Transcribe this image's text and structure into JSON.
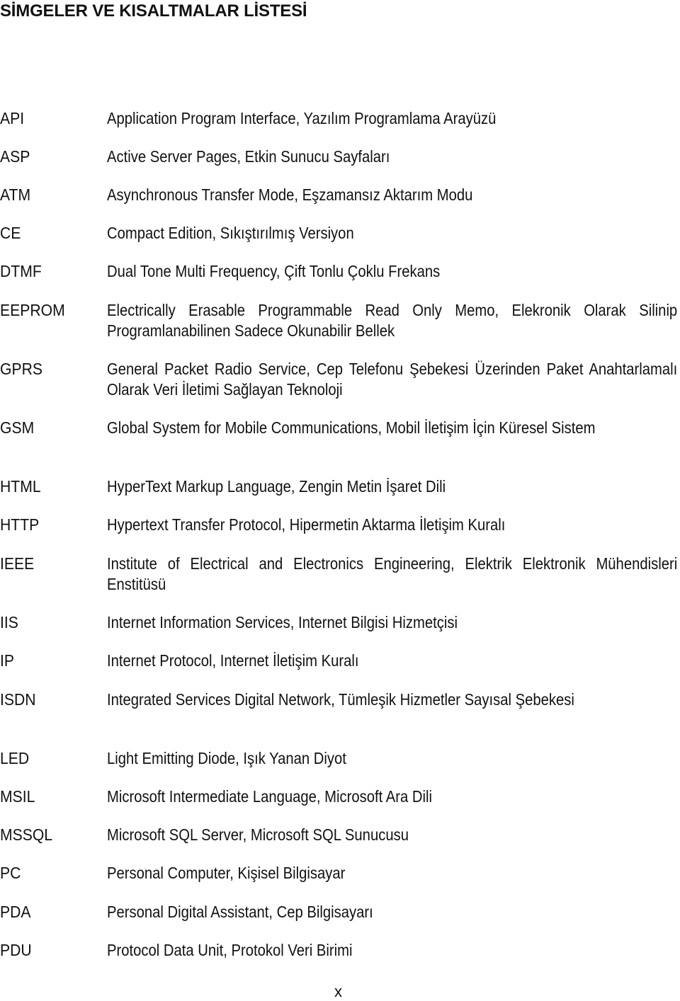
{
  "page": {
    "title": "SİMGELER VE KISALTMALAR LİSTESİ",
    "page_number": "x"
  },
  "entries": [
    {
      "abbr": "API",
      "desc": "Application Program Interface, Yazılım Programlama Arayüzü"
    },
    {
      "abbr": "ASP",
      "desc": "Active Server Pages, Etkin Sunucu Sayfaları"
    },
    {
      "abbr": "ATM",
      "desc": "Asynchronous Transfer Mode, Eşzamansız Aktarım Modu"
    },
    {
      "abbr": "CE",
      "desc": "Compact Edition, Sıkıştırılmış Versiyon"
    },
    {
      "abbr": "DTMF",
      "desc": "Dual Tone Multi Frequency, Çift Tonlu Çoklu Frekans"
    },
    {
      "abbr": "EEPROM",
      "desc": "Electrically Erasable Programmable Read Only Memo, Elekronik Olarak Silinip Programlanabilinen Sadece Okunabilir Bellek"
    },
    {
      "abbr": "GPRS",
      "desc": "General Packet Radio Service, Cep Telefonu Şebekesi Üzerinden Paket Anahtarlamalı Olarak Veri İletimi Sağlayan Teknoloji"
    },
    {
      "abbr": "GSM",
      "desc": "Global System for Mobile Communications, Mobil İletişim İçin Küresel Sistem"
    },
    {
      "abbr": "HTML",
      "desc": "HyperText Markup Language, Zengin Metin İşaret Dili"
    },
    {
      "abbr": "HTTP",
      "desc": "Hypertext Transfer Protocol, Hipermetin Aktarma İletişim Kuralı"
    },
    {
      "abbr": "IEEE",
      "desc": "Institute of Electrical and Electronics Engineering, Elektrik Elektronik Mühendisleri Enstitüsü"
    },
    {
      "abbr": "IIS",
      "desc": "Internet Information Services, Internet Bilgisi Hizmetçisi"
    },
    {
      "abbr": "IP",
      "desc": "Internet Protocol, Internet İletişim Kuralı"
    },
    {
      "abbr": "ISDN",
      "desc": "Integrated Services Digital Network, Tümleşik Hizmetler Sayısal Şebekesi"
    },
    {
      "abbr": "LED",
      "desc": "Light Emitting Diode, Işık Yanan Diyot"
    },
    {
      "abbr": "MSIL",
      "desc": "Microsoft Intermediate Language, Microsoft Ara Dili"
    },
    {
      "abbr": "MSSQL",
      "desc": "Microsoft SQL Server, Microsoft SQL Sunucusu"
    },
    {
      "abbr": "PC",
      "desc": "Personal Computer, Kişisel Bilgisayar"
    },
    {
      "abbr": "PDA",
      "desc": "Personal Digital Assistant, Cep Bilgisayarı"
    },
    {
      "abbr": "PDU",
      "desc": "Protocol Data Unit, Protokol Veri Birimi"
    }
  ]
}
